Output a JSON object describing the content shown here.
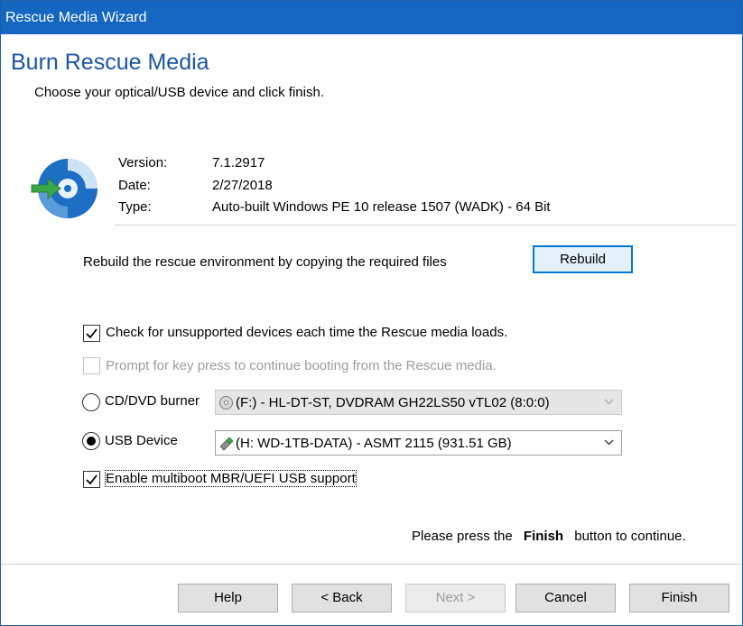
{
  "window": {
    "title": "Rescue Media Wizard"
  },
  "header": {
    "title": "Burn Rescue Media",
    "subtitle": "Choose your optical/USB device and click finish."
  },
  "info": {
    "version_label": "Version:",
    "version_value": "7.1.2917",
    "date_label": "Date:",
    "date_value": "2/27/2018",
    "type_label": "Type:",
    "type_value": "Auto-built Windows PE 10 release 1507 (WADK) - 64 Bit"
  },
  "rebuild": {
    "text": "Rebuild the rescue environment by copying the required files",
    "button_label": "Rebuild"
  },
  "options": {
    "check_unsupported": {
      "label": "Check for unsupported devices each time the Rescue media loads.",
      "checked": true
    },
    "prompt_key": {
      "label": "Prompt for key press to continue booting from the Rescue media.",
      "checked": false,
      "disabled": true
    },
    "multiboot": {
      "label": "Enable multiboot MBR/UEFI USB support",
      "checked": true
    }
  },
  "devices": {
    "cd_label": "CD/DVD burner",
    "cd_selected": false,
    "cd_value": "(F:) - HL-DT-ST, DVDRAM GH22LS50  vTL02 (8:0:0)",
    "usb_label": "USB Device",
    "usb_selected": true,
    "usb_value": "(H: WD-1TB-DATA) - ASMT     2115 (931.51 GB)"
  },
  "footer": {
    "prefix": "Please press the",
    "finish_word": "Finish",
    "suffix": "button to continue."
  },
  "buttons": {
    "help": "Help",
    "back": "< Back",
    "next": "Next >",
    "cancel": "Cancel",
    "finish": "Finish"
  },
  "colors": {
    "titlebar": "#1466c0",
    "heading": "#1a55a5",
    "accent_border": "#0078d7"
  },
  "icons": {
    "rescue_media": "disc-with-arrow-icon",
    "cd_drive": "optical-drive-icon",
    "usb_drive": "usb-drive-icon"
  }
}
